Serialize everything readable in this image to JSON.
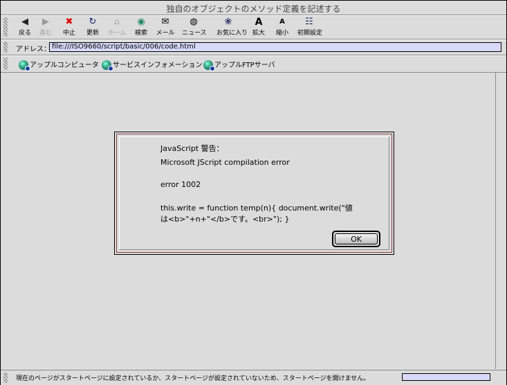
{
  "window": {
    "title": "独自のオブジェクトのメソッド定義を記述する"
  },
  "toolbar": {
    "buttons": [
      {
        "label": "戻る",
        "icon": "back-arrow-icon",
        "glyph": "◀"
      },
      {
        "label": "進む",
        "icon": "forward-arrow-icon",
        "glyph": "▶"
      },
      {
        "label": "中止",
        "icon": "stop-icon",
        "glyph": "✖"
      },
      {
        "label": "更新",
        "icon": "refresh-icon",
        "glyph": "↻"
      },
      {
        "label": "ホーム",
        "icon": "home-icon",
        "glyph": "⌂"
      },
      {
        "label": "検索",
        "icon": "search-globe-icon",
        "glyph": "◉"
      },
      {
        "label": "メール",
        "icon": "mail-icon",
        "glyph": "✉"
      },
      {
        "label": "ニュース",
        "icon": "news-icon",
        "glyph": "◍"
      },
      {
        "label": "お気に入り",
        "icon": "favorites-icon",
        "glyph": "❀"
      },
      {
        "label": "拡大",
        "icon": "font-larger-icon",
        "glyph": "A"
      },
      {
        "label": "縮小",
        "icon": "font-smaller-icon",
        "glyph": "A"
      },
      {
        "label": "初期設定",
        "icon": "preferences-icon",
        "glyph": "☷"
      }
    ]
  },
  "address": {
    "label": "アドレス：",
    "url": "file:///ISO9660/script/basic/006/code.html"
  },
  "favorites": [
    {
      "label": "アップルコンピュータ"
    },
    {
      "label": "サービスインフォメーション"
    },
    {
      "label": "アップルFTPサーバ"
    }
  ],
  "dialog": {
    "title": "JavaScript 警告：",
    "line1": "Microsoft JScript compilation error",
    "line2": "error 1002",
    "line3": " this.write = function temp(n){ document.write(\"値",
    "line4": "は<b>\"+n+\"</b>です。<br>\"); }",
    "ok_label": "OK"
  },
  "status": {
    "text": "現在のページがスタートページに設定されているか、スタートページが設定されていないため、スタートページを開けません。"
  }
}
